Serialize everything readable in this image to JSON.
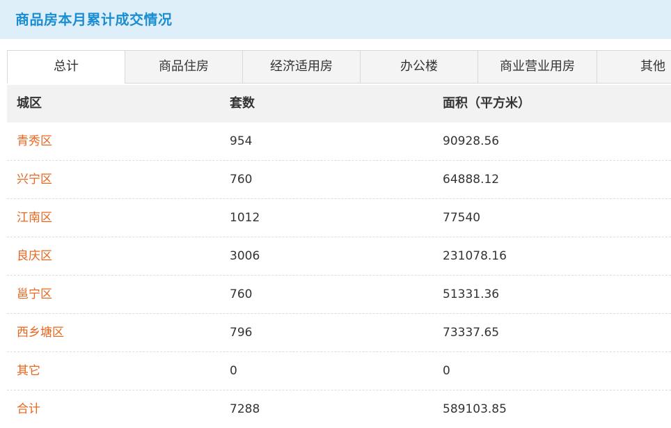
{
  "header": {
    "title": "商品房本月累计成交情况"
  },
  "tabs": [
    {
      "label": "总计",
      "active": true
    },
    {
      "label": "商品住房",
      "active": false
    },
    {
      "label": "经济适用房",
      "active": false
    },
    {
      "label": "办公楼",
      "active": false
    },
    {
      "label": "商业营业用房",
      "active": false
    },
    {
      "label": "其他",
      "active": false
    }
  ],
  "table": {
    "columns": [
      "城区",
      "套数",
      "面积（平方米）"
    ],
    "rows": [
      {
        "district": "青秀区",
        "units": "954",
        "area": "90928.56"
      },
      {
        "district": "兴宁区",
        "units": "760",
        "area": "64888.12"
      },
      {
        "district": "江南区",
        "units": "1012",
        "area": "77540"
      },
      {
        "district": "良庆区",
        "units": "3006",
        "area": "231078.16"
      },
      {
        "district": "邕宁区",
        "units": "760",
        "area": "51331.36"
      },
      {
        "district": "西乡塘区",
        "units": "796",
        "area": "73337.65"
      },
      {
        "district": "其它",
        "units": "0",
        "area": "0"
      },
      {
        "district": "合计",
        "units": "7288",
        "area": "589103.85"
      }
    ]
  },
  "colors": {
    "header_bg": "#deeffa",
    "title": "#1a8ed0",
    "district_link": "#e8661d",
    "table_header_bg": "#f2f2f2"
  }
}
